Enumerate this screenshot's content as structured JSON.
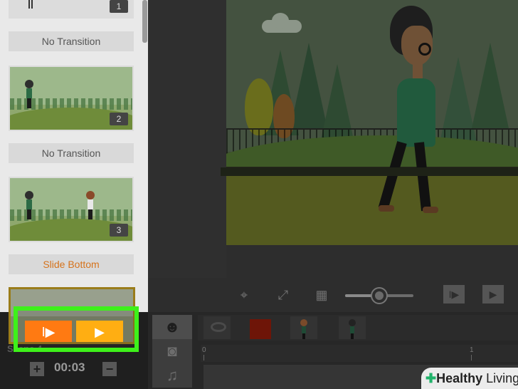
{
  "scene_list": {
    "items": [
      {
        "number": "1"
      },
      {
        "number": "2"
      },
      {
        "number": "3"
      }
    ],
    "transitions": [
      "No Transition",
      "No Transition",
      "Slide Bottom"
    ],
    "current_scene_label": "Scene 4"
  },
  "timing": {
    "duration": "00:03",
    "plus_label": "+",
    "minus_label": "−"
  },
  "controls": {
    "target_icon": "target-icon",
    "fullscreen_icon": "fullscreen-icon",
    "grid_icon": "grid-icon",
    "zoom_level": 0.5,
    "play_from_scene_icon": "play-from-scene-icon",
    "play_icon": "play-icon"
  },
  "timeline": {
    "tabs": [
      "character-tab",
      "camera-tab",
      "music-tab"
    ],
    "ruler_labels": [
      "0",
      "1"
    ]
  },
  "highlight": {
    "play_from_scene_label": "I▶",
    "play_label": "▶"
  },
  "watermark": {
    "brand_bold": "Healthy",
    "brand_rest": " Living"
  },
  "colors": {
    "highlight_border": "#3ef11a",
    "play_from_scene_button": "#ff7a12",
    "play_button": "#ffae12",
    "transition_active": "#d6731c"
  }
}
